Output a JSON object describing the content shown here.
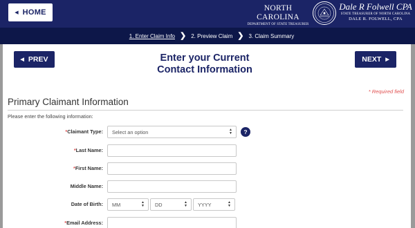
{
  "header": {
    "home_label": "HOME",
    "brand_line1": "NORTH CAROLINA",
    "brand_line2": "DEPARTMENT OF STATE TREASURER",
    "signature_line1": "STATE TREASURER OF NORTH CAROLINA",
    "signature_line2": "DALE R. FOLWELL, CPA"
  },
  "steps": [
    {
      "label": "1. Enter Claim Info",
      "active": true
    },
    {
      "label": "2. Preview Claim",
      "active": false
    },
    {
      "label": "3. Claim Summary",
      "active": false
    }
  ],
  "nav": {
    "prev_label": "PREV",
    "next_label": "NEXT"
  },
  "page": {
    "title_line1": "Enter your Current",
    "title_line2": "Contact Information",
    "required_note": "* Required field",
    "section_title": "Primary Claimant Information",
    "instructions": "Please enter the following information:"
  },
  "form": {
    "claimant_type": {
      "label": "Claimant Type:",
      "required": true,
      "value": "Select an option"
    },
    "last_name": {
      "label": "Last Name:",
      "required": true,
      "value": ""
    },
    "first_name": {
      "label": "First Name:",
      "required": true,
      "value": ""
    },
    "middle_name": {
      "label": "Middle Name:",
      "required": false,
      "value": ""
    },
    "dob": {
      "label": "Date of Birth:",
      "required": false,
      "month": "MM",
      "day": "DD",
      "year": "YYYY"
    },
    "email": {
      "label": "Email Address:",
      "required": true,
      "value": ""
    }
  },
  "help_icon": "?",
  "colors": {
    "navy": "#1b2466",
    "dark_navy": "#0d1749",
    "required_red": "#e05050",
    "frame_gray": "#9a9a9a"
  }
}
